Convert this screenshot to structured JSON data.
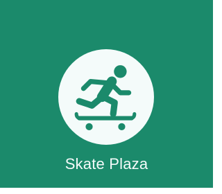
{
  "tile": {
    "label": "Skate Plaza",
    "icon": "skateboarder-icon",
    "colors": {
      "background": "#1b8a6b",
      "badge": "#f4fbfa",
      "icon": "#1b8a6b",
      "label": "#f4fbfa"
    }
  }
}
